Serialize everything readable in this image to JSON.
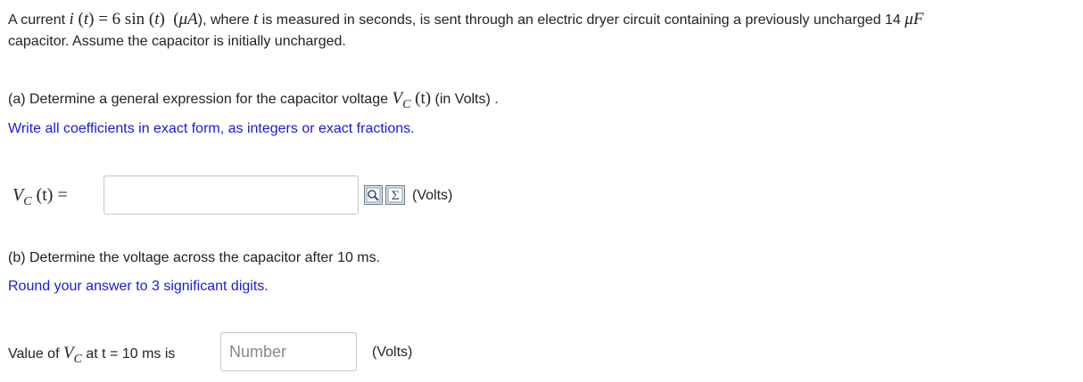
{
  "intro": {
    "prefix": "A current",
    "expr_i": "i",
    "expr_t": "t",
    "expr_rhs": "6 sin",
    "unit": "μA",
    "middle": "), where",
    "var_t": "t",
    "after_t": "is measured in seconds, is sent through an electric dryer circuit containing a previously uncharged 14",
    "cap_unit": "μF",
    "line2": "capacitor. Assume the capacitor is initially uncharged."
  },
  "part_a": {
    "prompt_prefix": "(a) Determine a general expression for the capacitor voltage",
    "vc_letter": "V",
    "vc_sub": "C",
    "vc_arg": "(t)",
    "prompt_suffix": "(in Volts) .",
    "hint": "Write all coefficients in exact form, as integers or exact fractions.",
    "answer_label_v": "V",
    "answer_label_sub": "C",
    "answer_label_rest": "(t) =",
    "answer_value": "",
    "units": "(Volts)"
  },
  "part_b": {
    "prompt": "(b) Determine the voltage across the capacitor after 10 ms.",
    "hint": "Round your answer to 3 significant digits.",
    "label_prefix": "Value of",
    "label_v": "V",
    "label_sub": "C",
    "label_suffix": "at t = 10 ms is",
    "placeholder": "Number",
    "units": "(Volts)"
  },
  "icons": [
    "preview-icon",
    "equation-editor-icon"
  ]
}
